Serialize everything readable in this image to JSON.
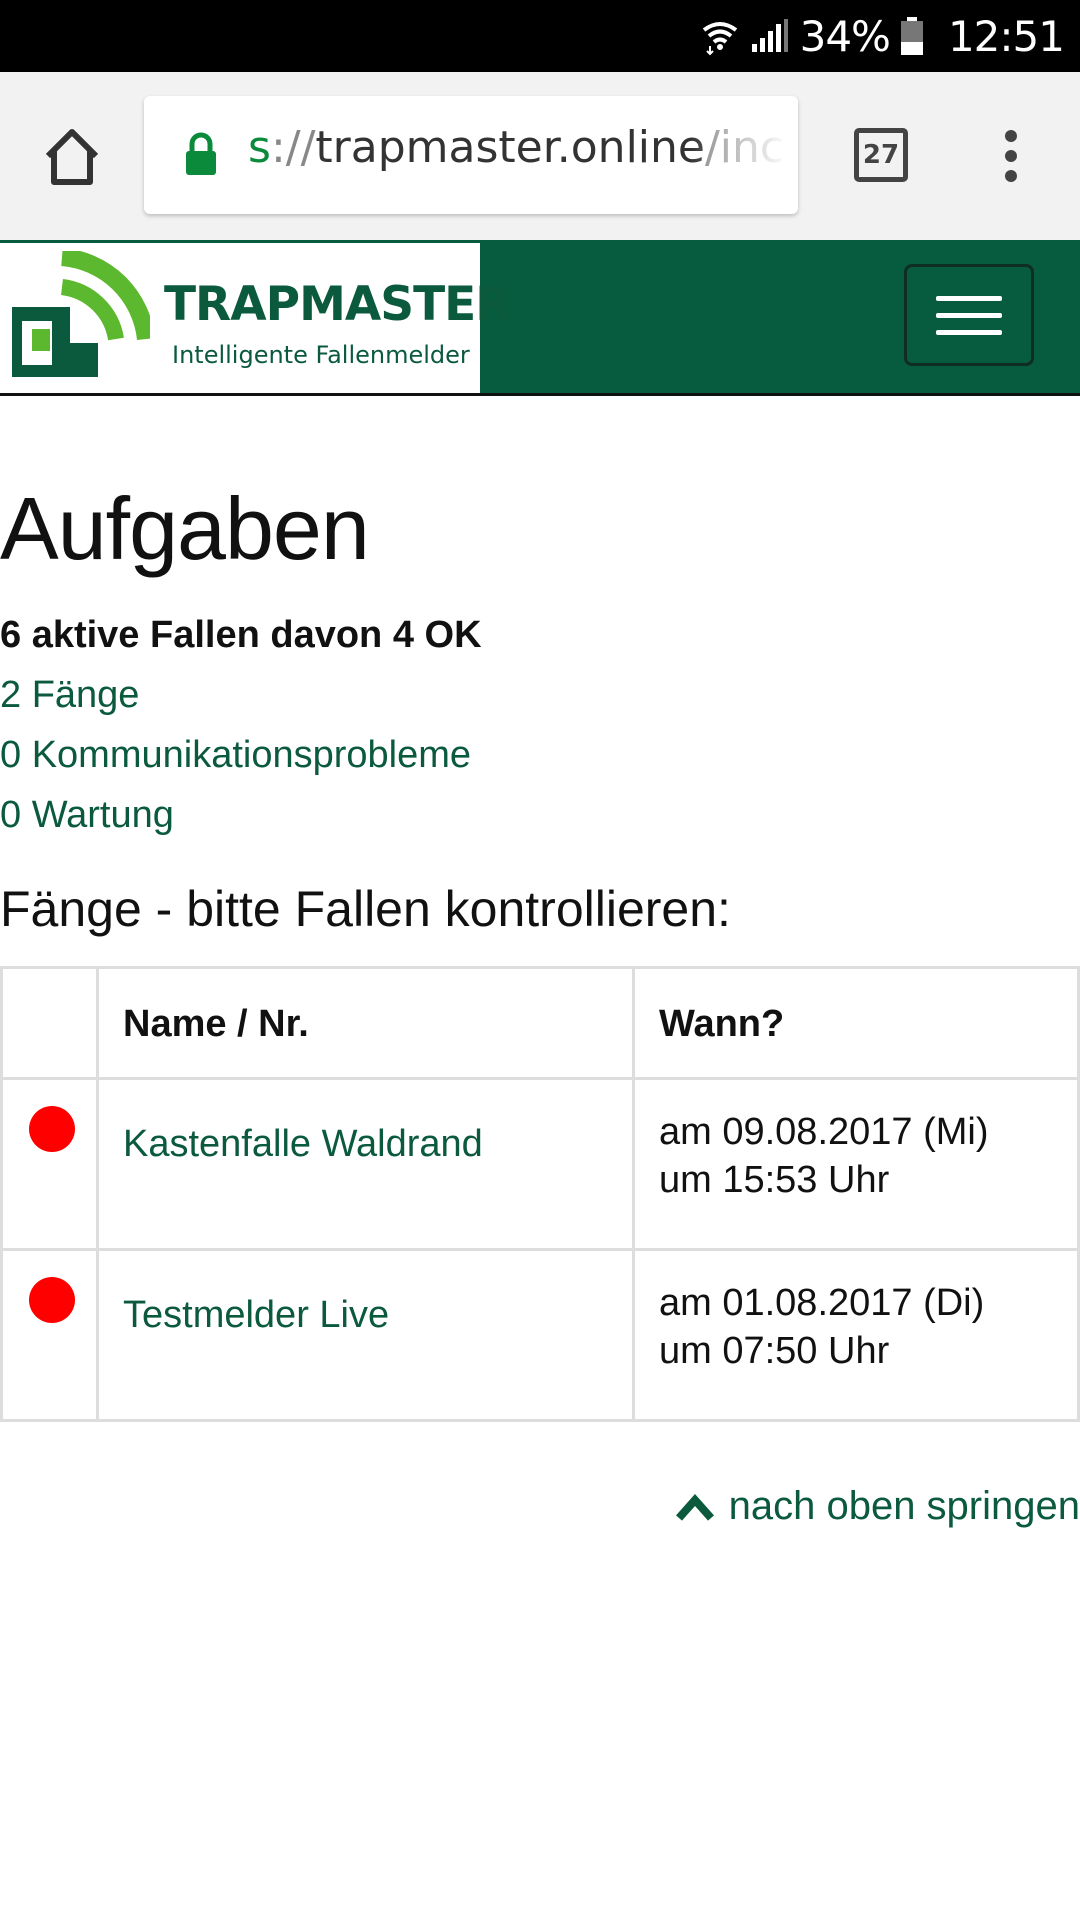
{
  "status_bar": {
    "battery_percent": "34%",
    "time": "12:51",
    "icons": [
      "wifi-icon",
      "signal-icon",
      "battery-icon"
    ]
  },
  "browser": {
    "url_scheme": "s",
    "url_sep": "://",
    "url_host": "trapmaster.online",
    "url_rest": "/inc",
    "tab_count": "27",
    "icons": [
      "home-icon",
      "lock-icon",
      "menu-dots-icon"
    ]
  },
  "site": {
    "logo_title": "TRAPMASTER",
    "logo_subtitle": "Intelligente Fallenmelder",
    "menu_icon": "hamburger-icon",
    "brand_color": "#075b3f"
  },
  "main": {
    "title": "Aufgaben",
    "summary": "6 aktive Fallen davon 4 OK",
    "stats": [
      {
        "label": "2 Fänge"
      },
      {
        "label": "0 Kommunikationsprobleme"
      },
      {
        "label": "0 Wartung"
      }
    ],
    "section_heading": "Fänge - bitte Fallen kontrollieren:",
    "table": {
      "headers": [
        "",
        "Name / Nr.",
        "Wann?"
      ],
      "rows": [
        {
          "status_color": "#ff0000",
          "name": "Kastenfalle Waldrand",
          "date": "am 09.08.2017 (Mi)",
          "time": "um 15:53 Uhr"
        },
        {
          "status_color": "#ff0000",
          "name": "Testmelder Live",
          "date": "am 01.08.2017 (Di)",
          "time": "um 07:50 Uhr"
        }
      ]
    },
    "back_to_top": "nach oben springen",
    "back_to_top_icon": "chevron-up-icon"
  }
}
